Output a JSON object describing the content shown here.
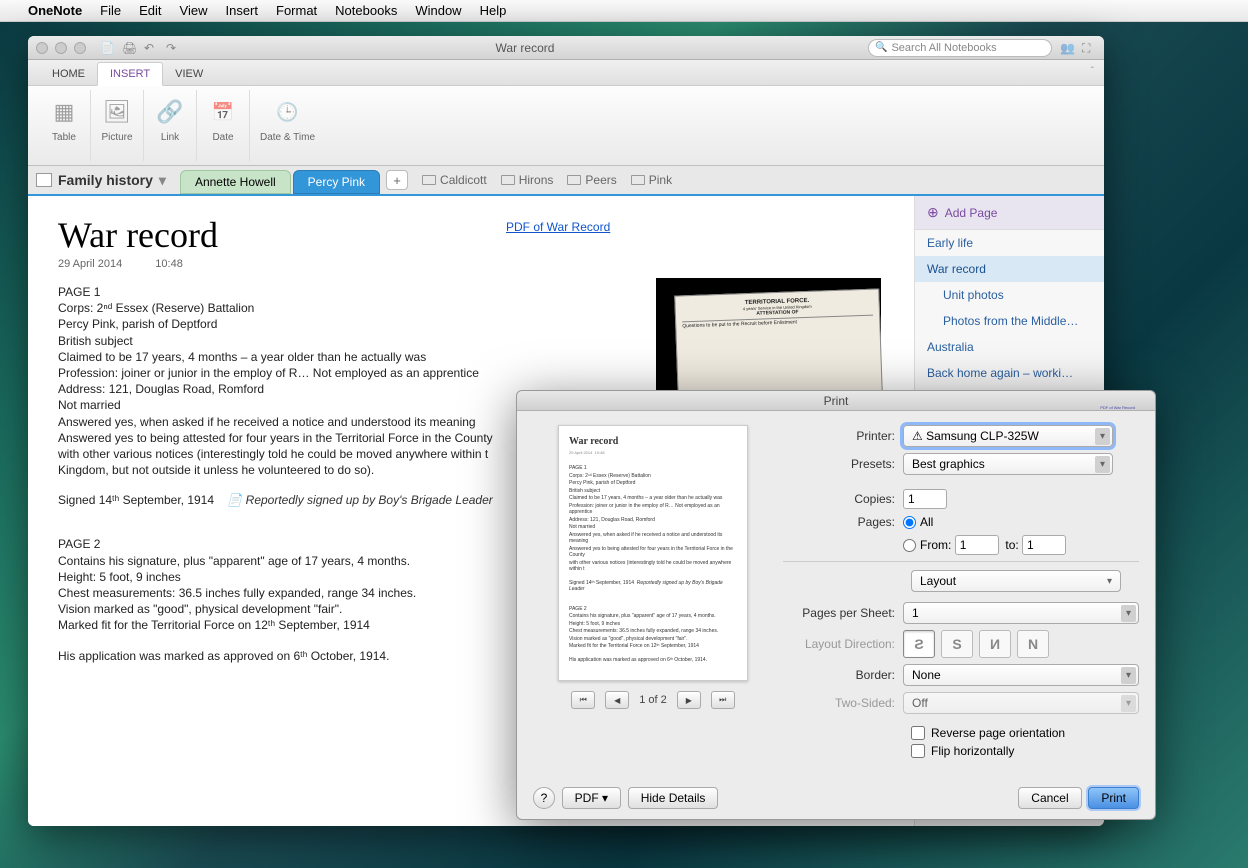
{
  "menubar": {
    "app": "OneNote",
    "items": [
      "File",
      "Edit",
      "View",
      "Insert",
      "Format",
      "Notebooks",
      "Window",
      "Help"
    ]
  },
  "window": {
    "title": "War record",
    "searchPlaceholder": "Search All Notebooks",
    "tabs": {
      "home": "HOME",
      "insert": "INSERT",
      "view": "VIEW"
    },
    "ribbon": {
      "table": "Table",
      "picture": "Picture",
      "link": "Link",
      "date": "Date",
      "datetime": "Date & Time"
    },
    "notebook": "Family history",
    "sections": {
      "annette": "Annette Howell",
      "percy": "Percy Pink"
    },
    "shortcuts": [
      "Caldicott",
      "Hirons",
      "Peers",
      "Pink"
    ]
  },
  "page": {
    "title": "War record",
    "date": "29 April 2014",
    "time": "10:48",
    "pdflink": "PDF of War Record",
    "body": {
      "p1h": "PAGE 1",
      "l1": "Corps: 2ⁿᵈ Essex (Reserve) Battalion",
      "l2": "Percy Pink, parish of Deptford",
      "l3": "British subject",
      "l4": "Claimed to be 17 years, 4 months – a year older than he actually was",
      "l5": "Profession: joiner or junior in the employ of R… Not employed as an apprentice",
      "l6": "Address: 121, Douglas Road, Romford",
      "l7": "Not married",
      "l8": "Answered yes, when asked if he received a notice and understood its meaning",
      "l9": "Answered yes to being attested for four years in the Territorial Force in the County",
      "l10": "with other various notices (interestingly told he could be moved anywhere within t",
      "l11": "Kingdom, but not outside it unless he volunteered to do so).",
      "sign": "Signed 14ᵗʰ September, 1914",
      "callout": "Reportedly signed up by Boy's Brigade Leader",
      "p2h": "PAGE 2",
      "l12": "Contains his signature, plus \"apparent\" age of 17 years, 4 months.",
      "l13": "Height: 5 foot, 9 inches",
      "l14": "Chest measurements: 36.5 inches fully expanded, range 34 inches.",
      "l15": "Vision marked as \"good\", physical development \"fair\".",
      "l16": "Marked fit for the Territorial Force on 12ᵗʰ September, 1914",
      "l17": "His application was marked as approved on 6ᵗʰ October, 1914."
    }
  },
  "sidebar": {
    "addpage": "Add Page",
    "items": [
      "Early life",
      "War record",
      "Unit photos",
      "Photos from the Middle…",
      "Australia",
      "Back home again – worki…"
    ]
  },
  "print": {
    "title": "Print",
    "labels": {
      "printer": "Printer:",
      "presets": "Presets:",
      "copies": "Copies:",
      "pages": "Pages:",
      "all": "All",
      "from": "From:",
      "to": "to:",
      "layout": "Layout",
      "pps": "Pages per Sheet:",
      "dir": "Layout Direction:",
      "border": "Border:",
      "twosided": "Two-Sided:",
      "reverse": "Reverse page orientation",
      "flip": "Flip horizontally"
    },
    "printer": "⚠ Samsung CLP-325W",
    "preset": "Best graphics",
    "copies": "1",
    "from": "1",
    "to": "1",
    "pps": "1",
    "border": "None",
    "twosided": "Off",
    "nav": "1 of 2",
    "buttons": {
      "help": "?",
      "pdf": "PDF ▾",
      "hide": "Hide Details",
      "cancel": "Cancel",
      "print": "Print"
    }
  }
}
